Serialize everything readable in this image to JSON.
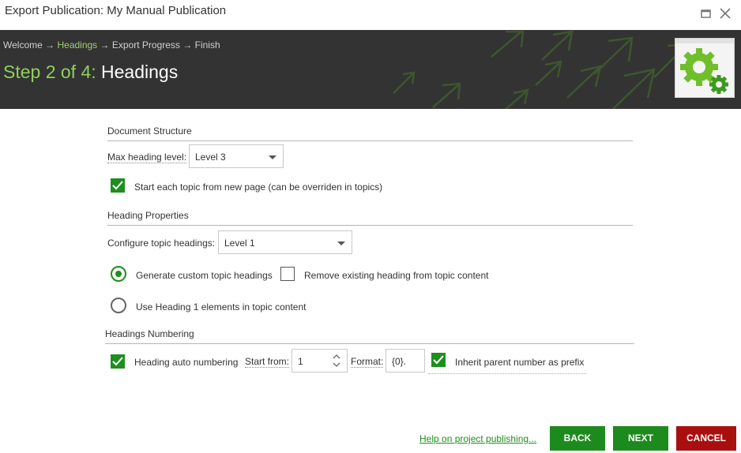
{
  "window": {
    "title": "Export Publication: My Manual Publication"
  },
  "wizard": {
    "breadcrumb": {
      "steps": [
        "Welcome",
        "Headings",
        "Export Progress",
        "Finish"
      ],
      "separator": "→",
      "active_index": 1
    },
    "step_prefix": "Step 2 of 4:",
    "step_name": "Headings"
  },
  "document_structure": {
    "section_title": "Document Structure",
    "max_heading_label": "Max heading level:",
    "max_heading_value": "Level 3",
    "new_page_checkbox": {
      "label": "Start each topic from new page (can be overriden in topics)",
      "checked": true
    }
  },
  "heading_properties": {
    "section_title": "Heading Properties",
    "configure_label": "Configure topic headings:",
    "configure_value": "Level 1",
    "generate_radio": {
      "label": "Generate custom topic headings",
      "selected": true
    },
    "remove_existing_checkbox": {
      "label": "Remove existing heading from topic content",
      "checked": false
    },
    "use_heading1_radio": {
      "label": "Use Heading 1 elements in topic content",
      "selected": false
    }
  },
  "headings_numbering": {
    "section_title": "Headings Numbering",
    "auto_numbering_checkbox": {
      "label": "Heading auto numbering",
      "checked": true
    },
    "start_from_label": "Start from:",
    "start_from_value": "1",
    "format_label": "Format:",
    "format_value": "{0}.",
    "inherit_checkbox": {
      "label": "Inherit parent number as prefix",
      "checked": true
    }
  },
  "footer": {
    "help_link": "Help on project publishing...",
    "back_label": "BACK",
    "next_label": "NEXT",
    "cancel_label": "CANCEL"
  },
  "colors": {
    "accent_green": "#1d8a1d",
    "header_bg": "#333333",
    "step_green": "#8fd05c",
    "cancel_red": "#a90f0f"
  },
  "icons": {
    "header_graphic": "gears-icon",
    "maximize": "maximize-icon",
    "close": "close-icon"
  }
}
